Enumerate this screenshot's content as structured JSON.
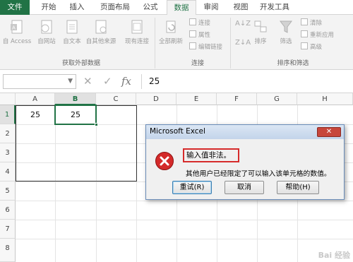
{
  "ribbon": {
    "tabs": [
      "文件",
      "开始",
      "插入",
      "页面布局",
      "公式",
      "数据",
      "审阅",
      "视图",
      "开发工具"
    ],
    "active_tab": "数据",
    "external_data": {
      "buttons": [
        "自 Access",
        "自网站",
        "自文本",
        "自其他来源",
        "现有连接"
      ],
      "group_label": "获取外部数据"
    },
    "connections": {
      "refresh_all": "全部刷新",
      "items": [
        "连接",
        "属性",
        "编辑链接"
      ],
      "group_label": "连接"
    },
    "sort_filter": {
      "sort": "排序",
      "filter": "筛选",
      "items": [
        "清除",
        "重新应用",
        "高级"
      ],
      "group_label": "排序和筛选"
    }
  },
  "formula_bar": {
    "name_box": "",
    "cancel_icon": "✕",
    "enter_icon": "✓",
    "fx_icon": "fx",
    "value": "25"
  },
  "sheet": {
    "columns": [
      "A",
      "B",
      "C",
      "D",
      "E",
      "F",
      "G",
      "H"
    ],
    "rows": [
      "1",
      "2",
      "3",
      "4",
      "5",
      "6",
      "7",
      "8"
    ],
    "cells": {
      "A1": "25",
      "B1": "25"
    },
    "selected_cell": "B1"
  },
  "dialog": {
    "title": "Microsoft Excel",
    "close": "✕",
    "message": "输入值非法。",
    "detail": "其他用户已经限定了可以输入该单元格的数值。",
    "buttons": [
      "重试(R)",
      "取消",
      "帮助(H)"
    ]
  },
  "watermark": "Bai 经验"
}
